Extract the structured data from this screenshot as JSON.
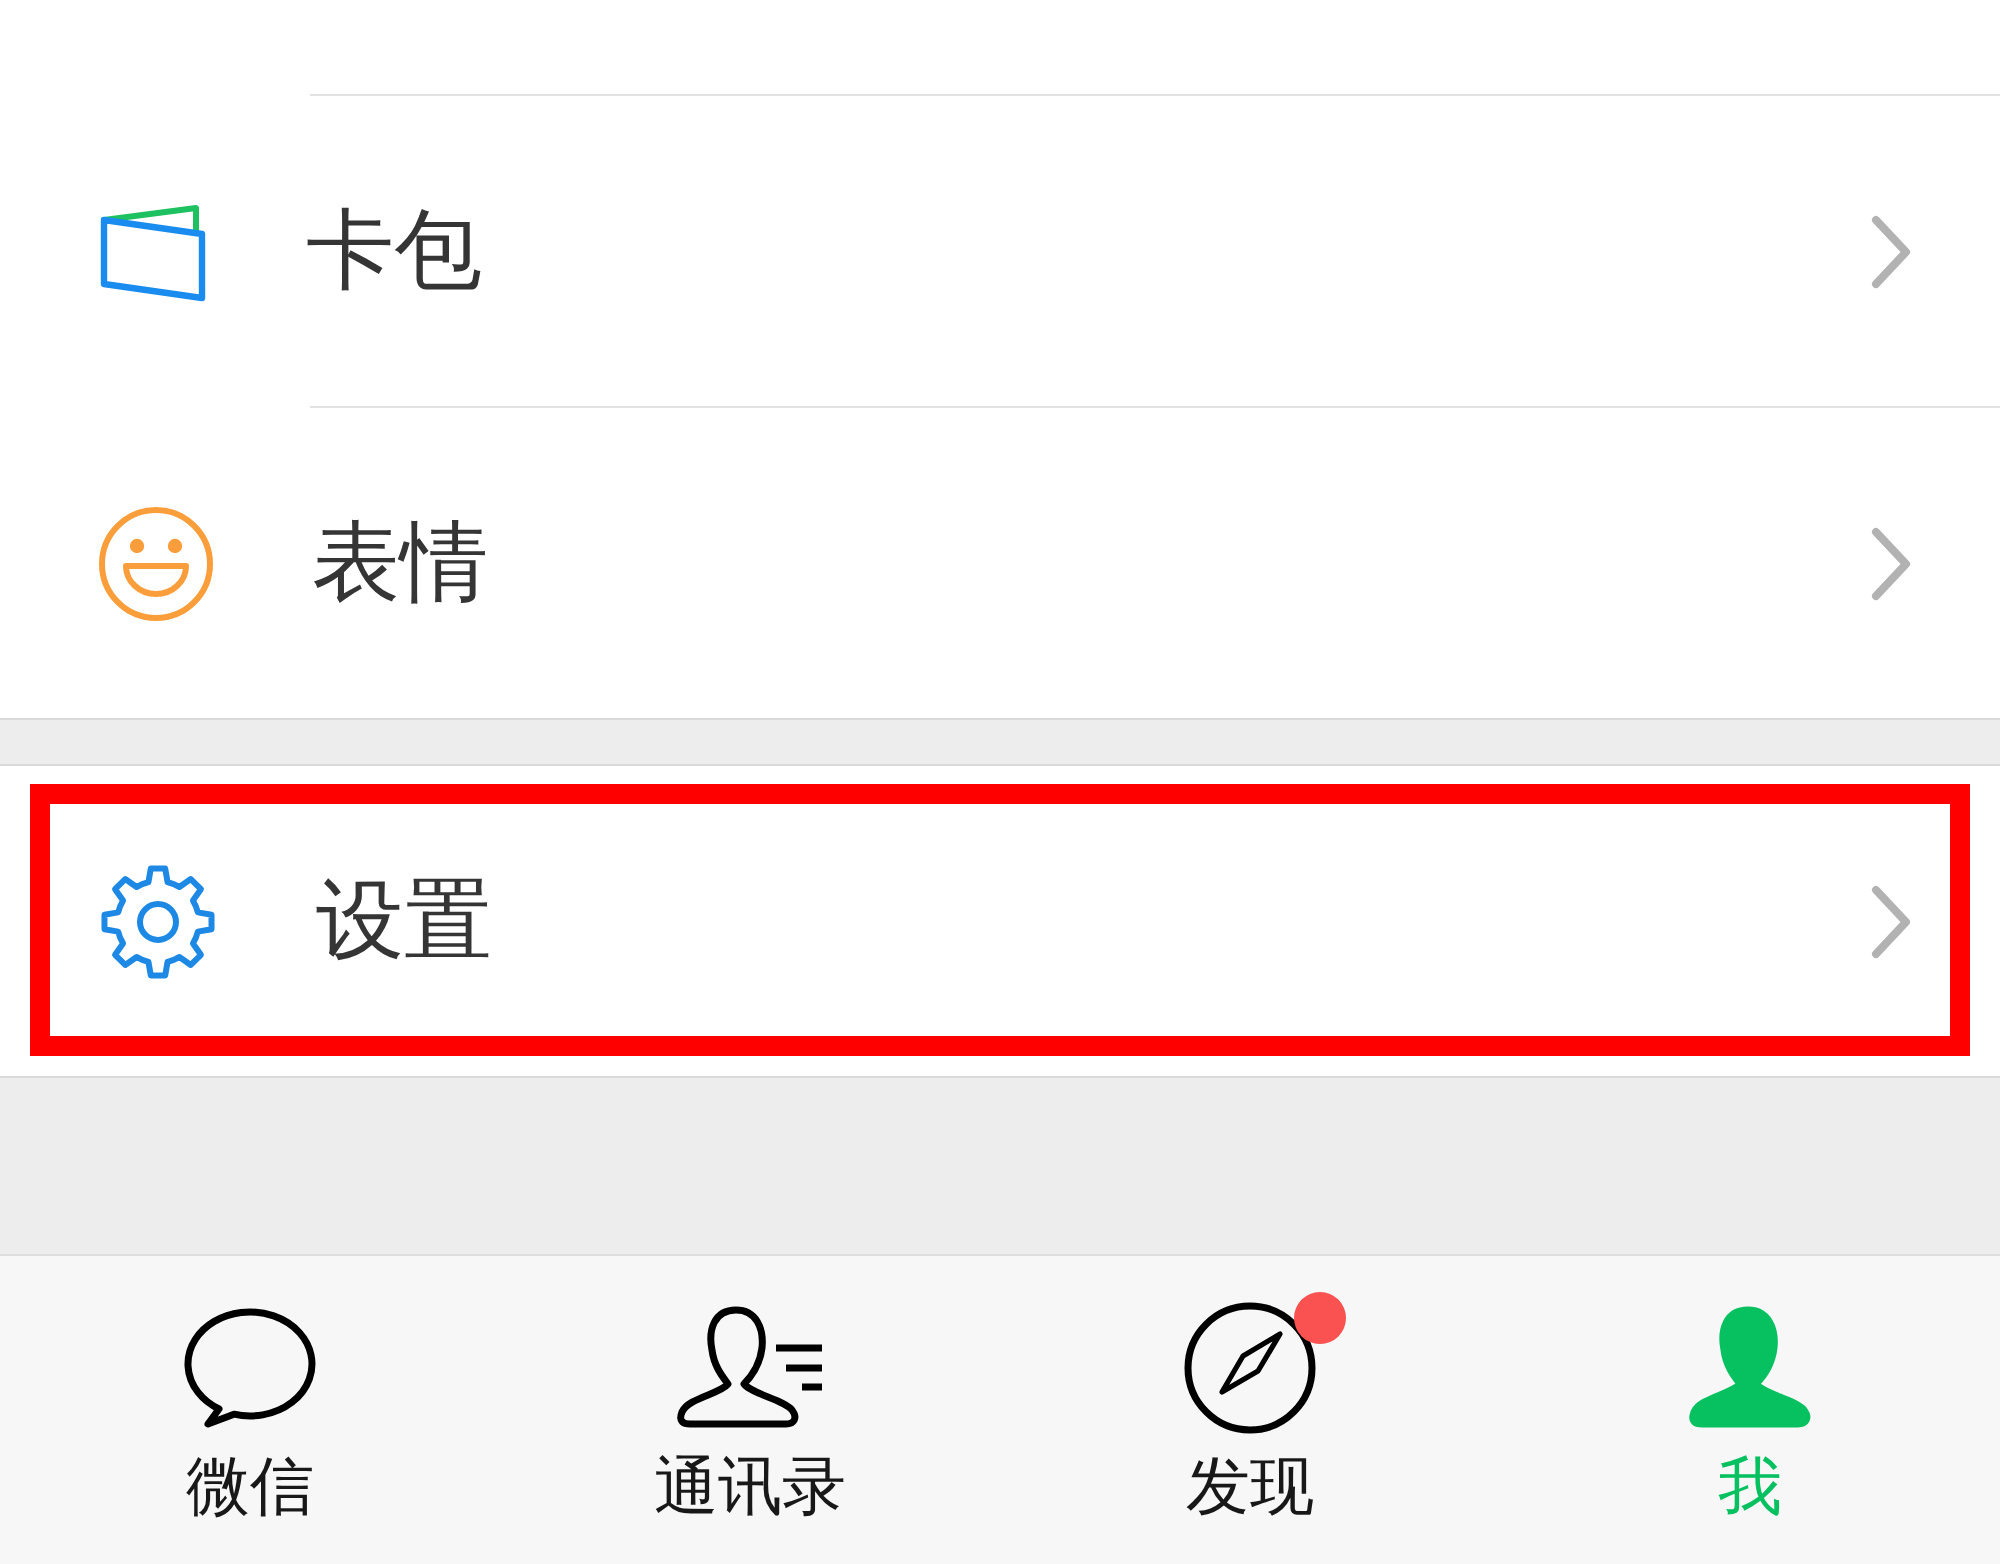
{
  "menu_sections": [
    {
      "items": [
        {
          "kind": "card",
          "label": "卡包",
          "highlighted": false
        },
        {
          "kind": "emoji",
          "label": "表情",
          "highlighted": false
        }
      ]
    },
    {
      "items": [
        {
          "kind": "settings",
          "label": "设置",
          "highlighted": true
        }
      ]
    }
  ],
  "tab_bar": {
    "tabs": [
      {
        "kind": "chats",
        "label": "微信",
        "selected": false,
        "badge_dot": false
      },
      {
        "kind": "contacts",
        "label": "通讯录",
        "selected": false,
        "badge_dot": false
      },
      {
        "kind": "discover",
        "label": "发现",
        "selected": false,
        "badge_dot": true
      },
      {
        "kind": "me",
        "label": "我",
        "selected": true,
        "badge_dot": false
      }
    ]
  }
}
